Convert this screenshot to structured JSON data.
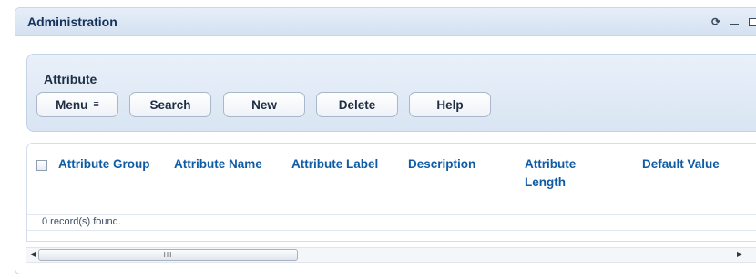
{
  "portlet": {
    "title": "Administration",
    "controls": [
      "refresh-icon",
      "minimize-icon",
      "restore-icon"
    ]
  },
  "attribute_panel": {
    "title": "Attribute",
    "buttons": {
      "menu": "Menu",
      "search": "Search",
      "new": "New",
      "delete": "Delete",
      "help": "Help"
    }
  },
  "grid": {
    "columns": [
      "Attribute Group",
      "Attribute Name",
      "Attribute Label",
      "Description",
      "Attribute Length",
      "Default Value"
    ],
    "rows": [],
    "status": "0 record(s) found."
  },
  "scrollbar": {
    "left_icon": "arrow-left-icon",
    "right_icon": "arrow-right-icon",
    "grip": "III"
  },
  "colors": {
    "header_text": "#0e5ba6",
    "title_bar": "#d4e1f1",
    "panel_bg": "#e3ecf7"
  }
}
